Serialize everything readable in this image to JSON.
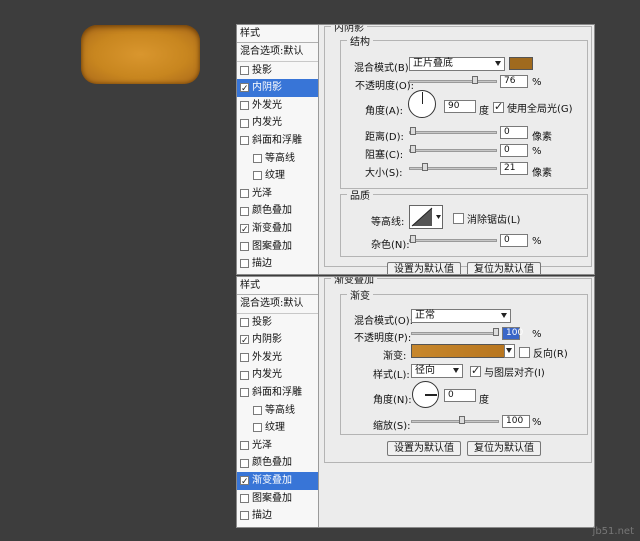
{
  "sidebar": {
    "title": "样式",
    "items": [
      {
        "label": "混合选项:默认"
      },
      {
        "label": "投影",
        "checked": false
      },
      {
        "label": "内阴影",
        "checked": true
      },
      {
        "label": "外发光",
        "checked": false
      },
      {
        "label": "内发光",
        "checked": false
      },
      {
        "label": "斜面和浮雕",
        "checked": false
      },
      {
        "label": "等高线",
        "checked": false
      },
      {
        "label": "纹理",
        "checked": false
      },
      {
        "label": "光泽",
        "checked": false
      },
      {
        "label": "颜色叠加",
        "checked": false
      },
      {
        "label": "渐变叠加",
        "checked": true
      },
      {
        "label": "图案叠加",
        "checked": false
      },
      {
        "label": "描边",
        "checked": false
      }
    ]
  },
  "inner_shadow": {
    "panel_title": "内阴影",
    "structure_title": "结构",
    "blend_mode_label": "混合模式(B):",
    "blend_mode_value": "正片叠底",
    "shadow_color": "#a06a1e",
    "opacity_label": "不透明度(O):",
    "opacity_value": "76",
    "angle_label": "角度(A):",
    "angle_value": "90",
    "degree_unit": "度",
    "global_light_label": "使用全局光(G)",
    "distance_label": "距离(D):",
    "distance_value": "0",
    "choke_label": "阻塞(C):",
    "choke_value": "0",
    "size_label": "大小(S):",
    "size_value": "21",
    "pixel_unit": "像素",
    "percent_unit": "%",
    "quality_title": "品质",
    "contour_label": "等高线:",
    "anti_alias_label": "消除锯齿(L)",
    "noise_label": "杂色(N):",
    "noise_value": "0",
    "make_default_label": "设置为默认值",
    "reset_default_label": "复位为默认值"
  },
  "gradient_overlay": {
    "panel_title": "渐变叠加",
    "section_title": "渐变",
    "blend_mode_label": "混合模式(O):",
    "blend_mode_value": "正常",
    "opacity_label": "不透明度(P):",
    "opacity_value": "100",
    "gradient_label": "渐变:",
    "gradient_color_start": "#c7872c",
    "gradient_color_end": "#b8761f",
    "reverse_label": "反向(R)",
    "style_label": "样式(L):",
    "style_value": "径向",
    "align_label": "与图层对齐(I)",
    "angle_label": "角度(N):",
    "angle_value": "0",
    "degree_unit": "度",
    "scale_label": "缩放(S):",
    "scale_value": "100",
    "percent_unit": "%",
    "make_default_label": "设置为默认值",
    "reset_default_label": "复位为默认值"
  },
  "preview": {
    "fill_color": "#cf8e27"
  },
  "watermark": "jb51.net"
}
